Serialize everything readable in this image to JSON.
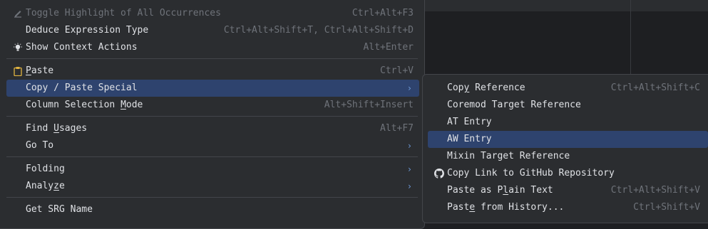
{
  "main_menu": {
    "items": [
      {
        "label": "Toggle Highlight of All Occurrences",
        "shortcut": "Ctrl+Alt+F3",
        "icon": "highlight-pen-icon"
      },
      {
        "label": "Deduce Expression Type",
        "shortcut": "Ctrl+Alt+Shift+T, Ctrl+Alt+Shift+D"
      },
      {
        "label": "Show Context Actions",
        "shortcut": "Alt+Enter",
        "icon": "lightbulb-icon"
      },
      {
        "label_pre": "",
        "label_u": "P",
        "label_post": "aste",
        "shortcut": "Ctrl+V",
        "icon": "clipboard-icon"
      },
      {
        "label": "Copy / Paste Special",
        "arrow": "›"
      },
      {
        "label_pre": "Column Selection ",
        "label_u": "M",
        "label_post": "ode",
        "shortcut": "Alt+Shift+Insert"
      },
      {
        "label_pre": "Find ",
        "label_u": "U",
        "label_post": "sages",
        "shortcut": "Alt+F7"
      },
      {
        "label": "Go To",
        "arrow": "›"
      },
      {
        "label": "Folding",
        "arrow": "›"
      },
      {
        "label_pre": "Analy",
        "label_u": "z",
        "label_post": "e",
        "arrow": "›"
      },
      {
        "label": "Get SRG Name"
      }
    ]
  },
  "sub_menu": {
    "items": [
      {
        "label_pre": "Cop",
        "label_u": "y",
        "label_post": " Reference",
        "shortcut": "Ctrl+Alt+Shift+C"
      },
      {
        "label": "Coremod Target Reference"
      },
      {
        "label": "AT Entry"
      },
      {
        "label": "AW Entry"
      },
      {
        "label": "Mixin Target Reference"
      },
      {
        "label": "Copy Link to GitHub Repository",
        "icon": "github-icon"
      },
      {
        "label_pre": "Paste as P",
        "label_u": "l",
        "label_post": "ain Text",
        "shortcut": "Ctrl+Alt+Shift+V"
      },
      {
        "label_pre": "Past",
        "label_u": "e",
        "label_post": " from History...",
        "shortcut": "Ctrl+Shift+V"
      }
    ]
  },
  "colors": {
    "highlight": "#2e436e",
    "menu_bg": "#2b2d30",
    "accent": "#6f9bd9"
  }
}
